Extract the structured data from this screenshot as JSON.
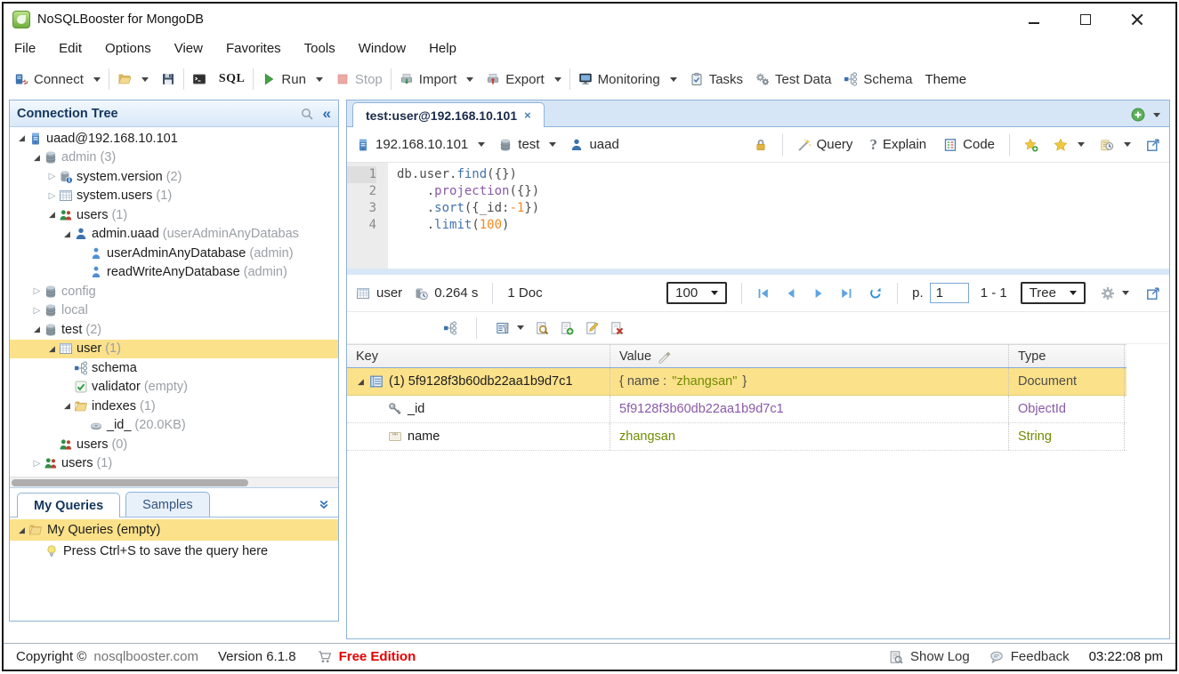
{
  "window": {
    "title": "NoSQLBooster for MongoDB"
  },
  "menu": [
    "File",
    "Edit",
    "Options",
    "View",
    "Favorites",
    "Tools",
    "Window",
    "Help"
  ],
  "toolbar": {
    "connect": "Connect",
    "sql": "SQL",
    "run": "Run",
    "stop": "Stop",
    "import": "Import",
    "export": "Export",
    "monitoring": "Monitoring",
    "tasks": "Tasks",
    "test_data": "Test Data",
    "schema": "Schema",
    "theme": "Theme"
  },
  "sidebar": {
    "title": "Connection Tree",
    "tree": [
      {
        "indent": 0,
        "arrow": "open",
        "icon": "server",
        "label": "uaad@192.168.10.101"
      },
      {
        "indent": 1,
        "arrow": "open",
        "icon": "database",
        "label": "admin",
        "suffix": "(3)",
        "dim": true
      },
      {
        "indent": 2,
        "arrow": "closed",
        "icon": "collection-info",
        "label": "system.version",
        "suffix": "(2)"
      },
      {
        "indent": 2,
        "arrow": "closed",
        "icon": "collection",
        "label": "system.users",
        "suffix": "(1)"
      },
      {
        "indent": 2,
        "arrow": "open",
        "icon": "users-group",
        "label": "users",
        "suffix": "(1)"
      },
      {
        "indent": 3,
        "arrow": "open",
        "icon": "user",
        "label": "admin.uaad",
        "suffix": "(userAdminAnyDatabas"
      },
      {
        "indent": 4,
        "arrow": "none",
        "icon": "role",
        "label": "userAdminAnyDatabase",
        "suffix": "(admin)"
      },
      {
        "indent": 4,
        "arrow": "none",
        "icon": "role",
        "label": "readWriteAnyDatabase",
        "suffix": "(admin)"
      },
      {
        "indent": 1,
        "arrow": "closed",
        "icon": "database",
        "label": "config",
        "dim": true
      },
      {
        "indent": 1,
        "arrow": "closed",
        "icon": "database",
        "label": "local",
        "dim": true
      },
      {
        "indent": 1,
        "arrow": "open",
        "icon": "database",
        "label": "test",
        "suffix": "(2)"
      },
      {
        "indent": 2,
        "arrow": "open",
        "icon": "collection",
        "label": "user",
        "suffix": "(1)",
        "selected": true
      },
      {
        "indent": 3,
        "arrow": "none",
        "icon": "schema",
        "label": "schema"
      },
      {
        "indent": 3,
        "arrow": "none",
        "icon": "validator",
        "label": "validator",
        "suffix": "(empty)"
      },
      {
        "indent": 3,
        "arrow": "open",
        "icon": "folder",
        "label": "indexes",
        "suffix": "(1)"
      },
      {
        "indent": 4,
        "arrow": "none",
        "icon": "index",
        "label": "_id_",
        "suffix": "(20.0KB)"
      },
      {
        "indent": 2,
        "arrow": "none",
        "icon": "users-group",
        "label": "users",
        "suffix": "(0)"
      },
      {
        "indent": 1,
        "arrow": "closed",
        "icon": "users-group",
        "label": "users",
        "suffix": "(1)"
      }
    ],
    "tabs": [
      {
        "label": "My Queries",
        "active": true
      },
      {
        "label": "Samples",
        "active": false
      }
    ],
    "query_items": [
      {
        "icon": "folder",
        "label": "My Queries (empty)",
        "selected": true,
        "arrow": "open"
      },
      {
        "icon": "lightbulb",
        "label": "Press Ctrl+S to save the query here",
        "indent": 1
      }
    ]
  },
  "main": {
    "tab_title": "test:user@192.168.10.101",
    "querybar": {
      "server": "192.168.10.101",
      "database": "test",
      "user": "uaad",
      "query_label": "Query",
      "explain_label": "Explain",
      "code_label": "Code"
    },
    "editor": {
      "lines": [
        {
          "num": "1",
          "tokens": [
            [
              "db",
              "t"
            ],
            [
              ".",
              "t"
            ],
            [
              "user",
              "t"
            ],
            [
              ".",
              "t"
            ],
            [
              "find",
              "fn"
            ],
            [
              "({})",
              "t"
            ]
          ]
        },
        {
          "num": "2",
          "tokens": [
            [
              "    .",
              "t"
            ],
            [
              "projection",
              "kw"
            ],
            [
              "({})",
              "t"
            ]
          ]
        },
        {
          "num": "3",
          "tokens": [
            [
              "    .",
              "t"
            ],
            [
              "sort",
              "fn"
            ],
            [
              "({",
              "t"
            ],
            [
              "_id",
              "t"
            ],
            [
              ":",
              "t"
            ],
            [
              "-1",
              "num"
            ],
            [
              "})",
              "t"
            ]
          ]
        },
        {
          "num": "4",
          "tokens": [
            [
              "    .",
              "t"
            ],
            [
              "limit",
              "fn"
            ],
            [
              "(",
              "t"
            ],
            [
              "100",
              "num"
            ],
            [
              ")",
              "t"
            ]
          ]
        }
      ]
    },
    "results_bar": {
      "collection": "user",
      "time": "0.264 s",
      "doc_count": "1 Doc",
      "page_size": "100",
      "page_prefix": "p.",
      "page": "1",
      "range": "1 - 1",
      "view_mode": "Tree"
    },
    "table": {
      "columns": [
        "Key",
        "Value",
        "Type"
      ],
      "rows": [
        {
          "arrow": true,
          "icon": "doc",
          "key": "(1) 5f9128f3b60db22aa1b9d7c1",
          "value": [
            [
              "{ name : ",
              "t"
            ],
            [
              "\"zhangsan\"",
              "str"
            ],
            [
              " }",
              "t"
            ]
          ],
          "type": "Document",
          "type_class": "t",
          "selected": true
        },
        {
          "icon": "key",
          "indent": 1,
          "key": "_id",
          "value": [
            [
              "5f9128f3b60db22aa1b9d7c1",
              "oid"
            ]
          ],
          "type": "ObjectId",
          "type_class": "oid"
        },
        {
          "icon": "quote",
          "indent": 1,
          "key": "name",
          "value": [
            [
              "zhangsan",
              "str"
            ]
          ],
          "type": "String",
          "type_class": "str"
        }
      ]
    }
  },
  "statusbar": {
    "copyright": "Copyright ©",
    "site": "nosqlbooster.com",
    "version": "Version 6.1.8",
    "edition": "Free Edition",
    "show_log": "Show Log",
    "feedback": "Feedback",
    "time": "03:22:08 pm"
  }
}
